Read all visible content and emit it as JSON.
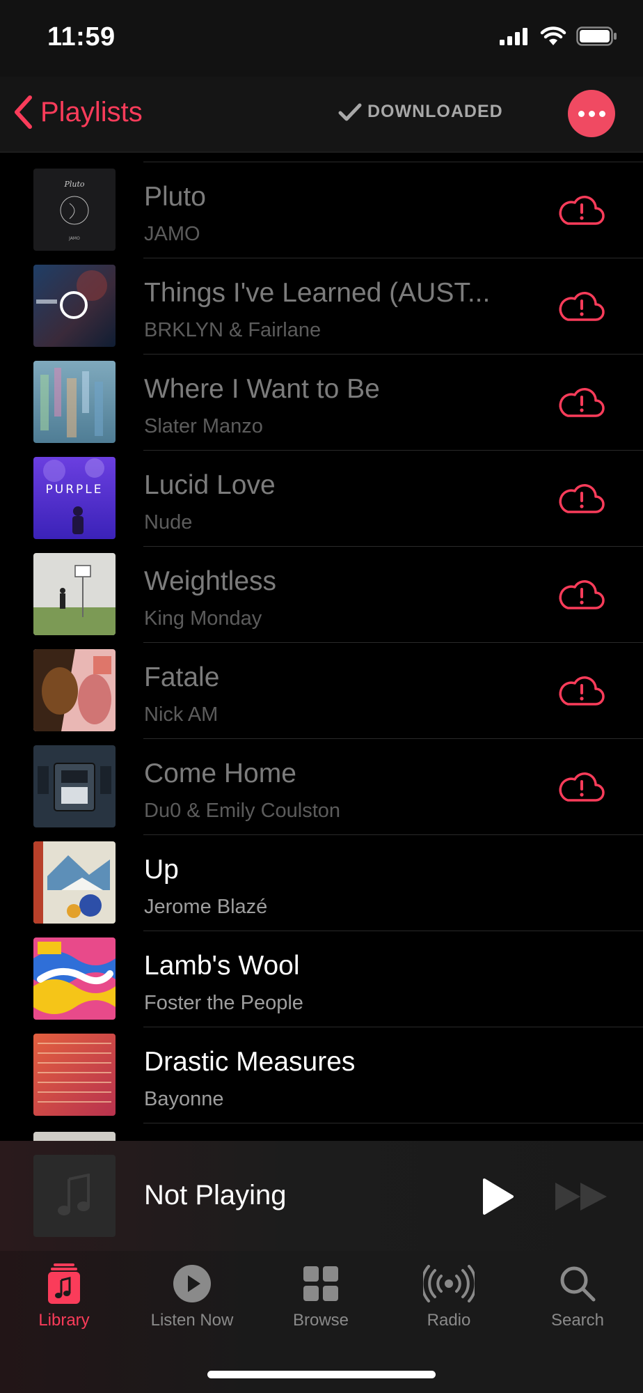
{
  "status": {
    "time": "11:59"
  },
  "nav": {
    "back_label": "Playlists",
    "filter_label": "DOWNLOADED"
  },
  "tracks": [
    {
      "title": "Pluto",
      "artist": "JAMO",
      "downloaded": false
    },
    {
      "title": "Things I've Learned (AUST...",
      "artist": "BRKLYN & Fairlane",
      "downloaded": false
    },
    {
      "title": "Where I Want to Be",
      "artist": "Slater Manzo",
      "downloaded": false
    },
    {
      "title": "Lucid Love",
      "artist": "Nude",
      "downloaded": false
    },
    {
      "title": "Weightless",
      "artist": "King Monday",
      "downloaded": false
    },
    {
      "title": "Fatale",
      "artist": "Nick AM",
      "downloaded": false
    },
    {
      "title": "Come Home",
      "artist": "Du0 & Emily Coulston",
      "downloaded": false
    },
    {
      "title": "Up",
      "artist": "Jerome Blazé",
      "downloaded": true
    },
    {
      "title": "Lamb's Wool",
      "artist": "Foster the People",
      "downloaded": true
    },
    {
      "title": "Drastic Measures",
      "artist": "Bayonne",
      "downloaded": true
    }
  ],
  "player": {
    "title": "Not Playing"
  },
  "tabs": [
    {
      "label": "Library",
      "icon": "library-icon",
      "active": true
    },
    {
      "label": "Listen Now",
      "icon": "play-circle-icon",
      "active": false
    },
    {
      "label": "Browse",
      "icon": "grid-icon",
      "active": false
    },
    {
      "label": "Radio",
      "icon": "radio-icon",
      "active": false
    },
    {
      "label": "Search",
      "icon": "search-icon",
      "active": false
    }
  ],
  "colors": {
    "accent": "#fa3c5a",
    "background": "#000000"
  }
}
